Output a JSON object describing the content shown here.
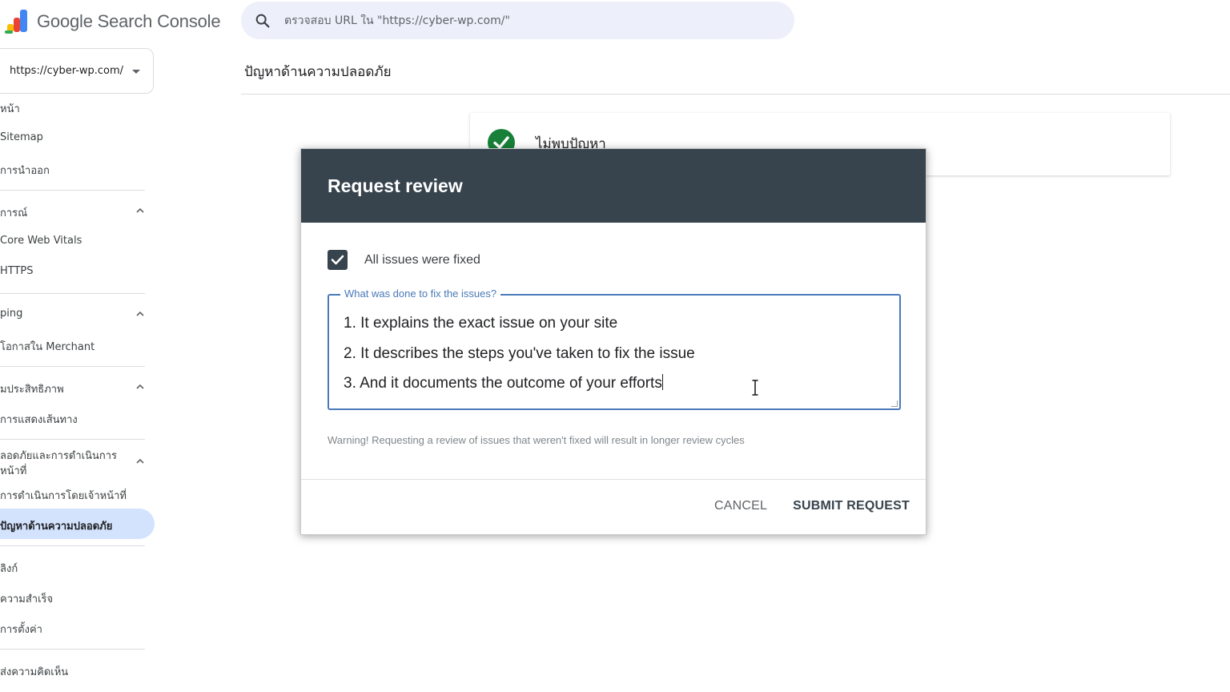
{
  "app": {
    "title": "Google Search Console"
  },
  "search": {
    "placeholder": "ตรวจสอบ URL ใน \"https://cyber-wp.com/\""
  },
  "property": {
    "url": "https://cyber-wp.com/"
  },
  "sidebar": {
    "items": [
      {
        "label": "หน้า"
      },
      {
        "label": "Sitemap"
      },
      {
        "label": "การนำออก"
      },
      {
        "label": "การณ์",
        "section": true
      },
      {
        "label": "Core Web Vitals"
      },
      {
        "label": "HTTPS"
      },
      {
        "label": "ping",
        "section": true
      },
      {
        "label": "โอกาสใน Merchant"
      },
      {
        "label": "มประสิทธิภาพ",
        "section": true
      },
      {
        "label": "การแสดงเส้นทาง"
      },
      {
        "label": "ลอดภัยและการดำเนินการ",
        "section": true
      },
      {
        "label": "หน้าที่",
        "section": true
      },
      {
        "label": "การดำเนินการโดยเจ้าหน้าที่"
      },
      {
        "label": "ปัญหาด้านความปลอดภัย",
        "active": true
      },
      {
        "label": "ลิงก์"
      },
      {
        "label": "ความสำเร็จ"
      },
      {
        "label": "การตั้งค่า"
      },
      {
        "label": "ส่งความคิดเห็น"
      }
    ]
  },
  "main": {
    "page_title": "ปัญหาด้านความปลอดภัย",
    "status_text": "ไม่พบปัญหา"
  },
  "dialog": {
    "title": "Request review",
    "checkbox_label": "All issues were fixed",
    "checkbox_checked": true,
    "field_label": "What was done to fix the issues?",
    "field_lines": [
      "1. It explains the exact issue on your site",
      "2. It describes the steps you've taken to fix the issue",
      "3. And it documents the outcome of your efforts"
    ],
    "warning": "Warning! Requesting a review of issues that weren't fixed will result in longer review cycles",
    "cancel_label": "CANCEL",
    "submit_label": "SUBMIT REQUEST"
  },
  "colors": {
    "dialog_header": "#37434d",
    "active_nav": "#d3e3fd",
    "search_bg": "#edf0fb",
    "success": "#188038",
    "field_border": "#4a7ab8"
  }
}
